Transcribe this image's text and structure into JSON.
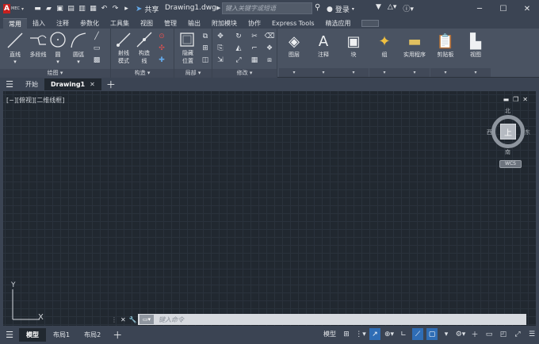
{
  "titlebar": {
    "logo_letter": "A",
    "logo_sub": "MEC",
    "share_label": "共享",
    "document_title": "Drawing1.dwg",
    "search_placeholder": "键入关键字或短语",
    "login_label": "登录"
  },
  "ribbon_tabs": [
    {
      "label": "常用",
      "active": true
    },
    {
      "label": "插入"
    },
    {
      "label": "注释"
    },
    {
      "label": "参数化"
    },
    {
      "label": "工具集"
    },
    {
      "label": "视图"
    },
    {
      "label": "管理"
    },
    {
      "label": "输出"
    },
    {
      "label": "附加模块"
    },
    {
      "label": "协作"
    },
    {
      "label": "Express Tools"
    },
    {
      "label": "精选应用"
    }
  ],
  "ribbon": {
    "draw": {
      "title": "绘图",
      "line": "直线",
      "polyline": "多段线",
      "circle": "圆",
      "arc": "圆弧"
    },
    "construct": {
      "title": "构造",
      "ray": "射线",
      "ray_mode": "模式",
      "xline": "构造",
      "xline2": "线"
    },
    "section": {
      "title": "局部",
      "hide": "隐藏",
      "hide2": "位置"
    },
    "modify": {
      "title": "修改"
    },
    "layers": {
      "label": "图层"
    },
    "annotation": {
      "label": "注释"
    },
    "block": {
      "label": "块"
    },
    "group": {
      "label": "组"
    },
    "utilities": {
      "label": "实用程序"
    },
    "clipboard": {
      "label": "剪贴板"
    },
    "view": {
      "label": "视图"
    }
  },
  "doc_tabs": {
    "start": "开始",
    "drawing": "Drawing1"
  },
  "canvas": {
    "viewport_label": "[−][俯视][二维线框]",
    "viewcube": {
      "top": "上",
      "north": "北",
      "south": "南",
      "west": "西",
      "east": "东"
    },
    "wcs": "WCS",
    "ucs_y": "Y",
    "ucs_x": "X"
  },
  "command": {
    "placeholder": "键入命令"
  },
  "status": {
    "tabs": [
      {
        "label": "模型",
        "active": true
      },
      {
        "label": "布局1"
      },
      {
        "label": "布局2"
      }
    ],
    "model_label": "模型"
  }
}
